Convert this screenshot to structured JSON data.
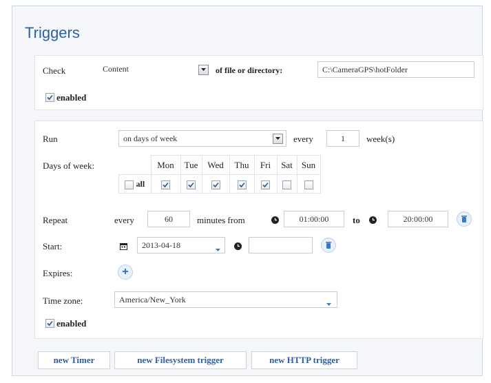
{
  "title": "Triggers",
  "check": {
    "label": "Check",
    "type_value": "Content",
    "of_label": "of file or directory:",
    "path_value": "C:\\CameraGPS\\hotFolder",
    "enabled_label": "enabled",
    "enabled_checked": true
  },
  "timer": {
    "run_label": "Run",
    "run_value": "on days of week",
    "every_label": "every",
    "every_value": "1",
    "weeks_label": "week(s)",
    "days_label": "Days of week:",
    "days": [
      {
        "label": "Mon",
        "checked": true
      },
      {
        "label": "Tue",
        "checked": true
      },
      {
        "label": "Wed",
        "checked": true
      },
      {
        "label": "Thu",
        "checked": true
      },
      {
        "label": "Fri",
        "checked": true
      },
      {
        "label": "Sat",
        "checked": false
      },
      {
        "label": "Sun",
        "checked": false
      }
    ],
    "all_label": "all",
    "repeat_label": "Repeat",
    "repeat_every_label": "every",
    "repeat_minutes": "60",
    "minutes_from_label": "minutes from",
    "from_time": "01:00:00",
    "to_label": "to",
    "to_time": "20:00:00",
    "start_label": "Start:",
    "start_date": "2013-04-18",
    "start_time": "",
    "expires_label": "Expires:",
    "timezone_label": "Time zone:",
    "timezone_value": "America/New_York",
    "enabled_label": "enabled",
    "enabled_checked": true
  },
  "buttons": {
    "new_timer": "new Timer",
    "new_filesystem": "new Filesystem trigger",
    "new_http": "new HTTP trigger"
  },
  "colors": {
    "title": "#2e5fa3",
    "panel_border": "#dde3ea",
    "background": "#f4f6f9"
  }
}
